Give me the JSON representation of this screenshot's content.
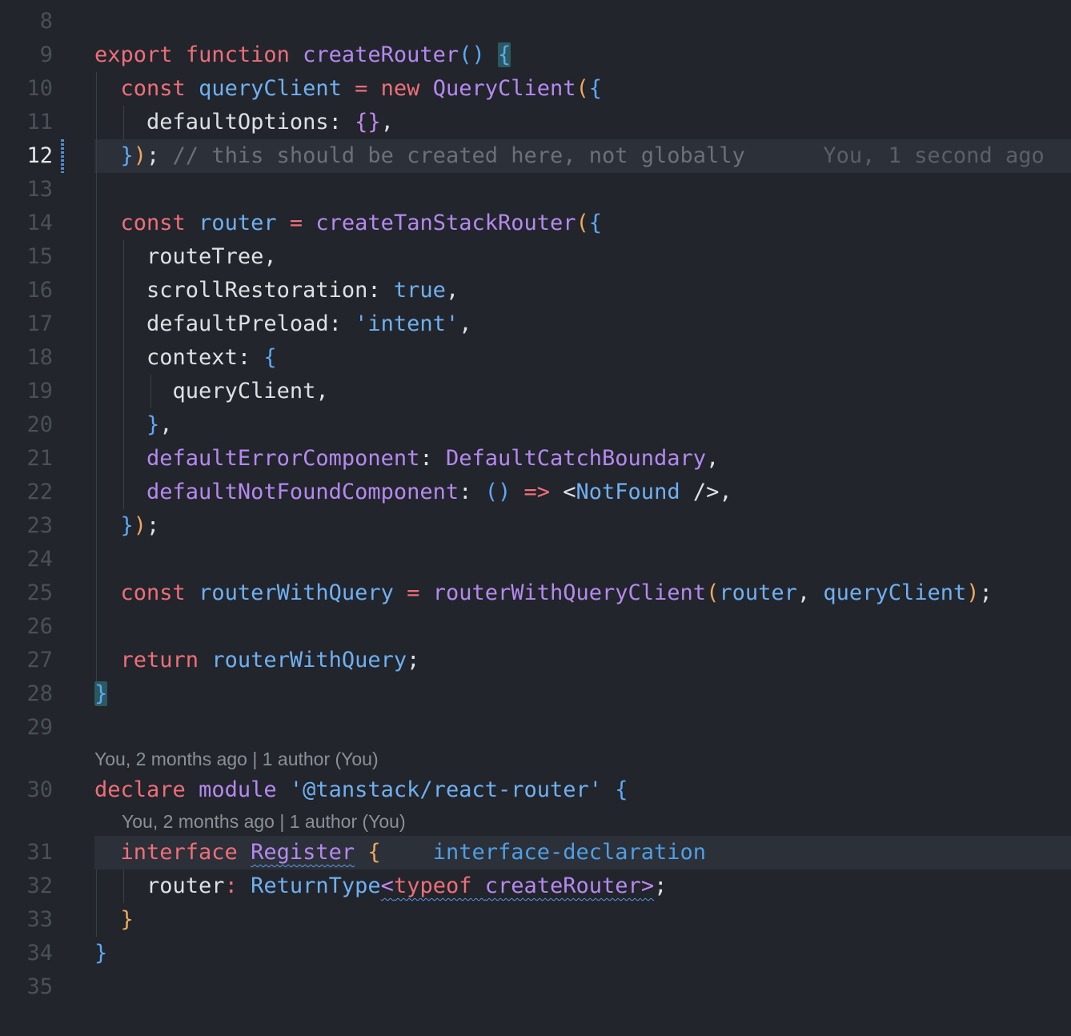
{
  "gutter": {
    "lines": [
      "8",
      "9",
      "10",
      "11",
      "12",
      "13",
      "14",
      "15",
      "16",
      "17",
      "18",
      "19",
      "20",
      "21",
      "22",
      "23",
      "24",
      "25",
      "26",
      "27",
      "28",
      "29",
      "30",
      "31",
      "32",
      "33",
      "34",
      "35"
    ],
    "active_line": "12"
  },
  "code": {
    "l9": [
      "export",
      "function",
      "createRouter",
      "()",
      " ",
      "{"
    ],
    "l10": [
      "const",
      "queryClient",
      "=",
      "new",
      "QueryClient",
      "(",
      "{"
    ],
    "l11": [
      "defaultOptions",
      ":",
      "{}",
      ","
    ],
    "l12": [
      "}",
      ")",
      ";",
      "// this should be created here, not globally"
    ],
    "l14": [
      "const",
      "router",
      "=",
      "createTanStackRouter",
      "(",
      "{"
    ],
    "l15": [
      "routeTree,"
    ],
    "l16": [
      "scrollRestoration",
      ":",
      "true",
      ","
    ],
    "l17": [
      "defaultPreload",
      ":",
      "'intent'",
      ","
    ],
    "l18": [
      "context",
      ":",
      "{"
    ],
    "l19": [
      "queryClient,"
    ],
    "l20": [
      "}",
      ","
    ],
    "l21": [
      "defaultErrorComponent",
      ":",
      "DefaultCatchBoundary",
      ","
    ],
    "l22": [
      "defaultNotFoundComponent",
      ":",
      "()",
      "=>",
      "<",
      "NotFound",
      "/>",
      ","
    ],
    "l23": [
      "}",
      ")",
      ";"
    ],
    "l25": [
      "const",
      "routerWithQuery",
      "=",
      "routerWithQueryClient",
      "(",
      "router",
      ",",
      "queryClient",
      ")",
      ";"
    ],
    "l27": [
      "return",
      "routerWithQuery",
      ";"
    ],
    "l28": [
      "}"
    ],
    "l30": [
      "declare",
      "module",
      "'@tanstack/react-router'",
      "{"
    ],
    "l31": [
      "interface",
      "Register",
      "{"
    ],
    "l32": [
      "router",
      ":",
      "ReturnType",
      "<",
      "typeof",
      "createRouter",
      ">",
      ";"
    ],
    "l33": [
      "}"
    ],
    "l34": [
      "}"
    ]
  },
  "blame_inline": "You, 1 second ago",
  "codelens": {
    "module": "You, 2 months ago | 1 author (You)",
    "interface": "You, 2 months ago | 1 author (You)"
  },
  "inline_hint": "interface-declaration",
  "colors": {
    "background": "#22252b",
    "keyword": "#ee6f7a",
    "function": "#b589f0",
    "variable": "#6fb0f2",
    "comment": "#6b7079",
    "bracket_match": "#2a5a60",
    "dirty_indicator": "#4f8fd6"
  }
}
